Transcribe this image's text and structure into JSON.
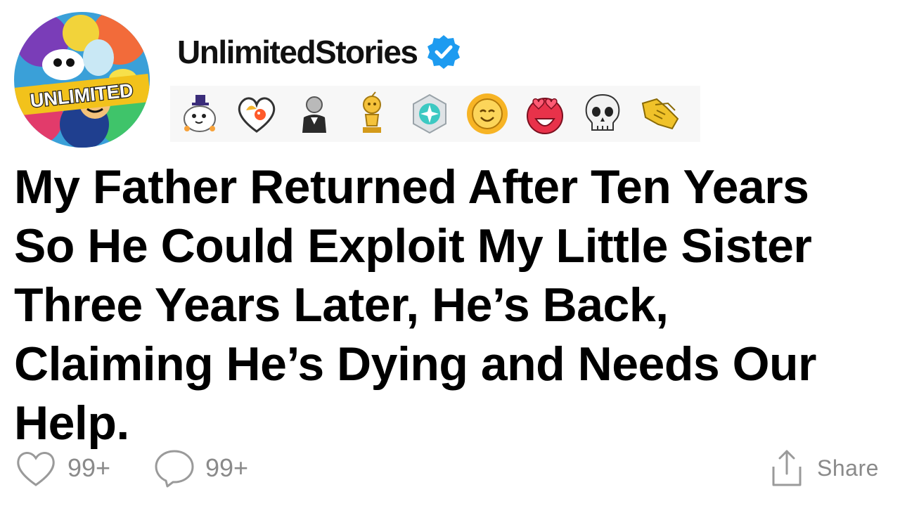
{
  "avatar": {
    "badge_text": "UNLIMITED"
  },
  "user": {
    "username": "UnlimitedStories",
    "verified": true,
    "verified_color": "#1d9bf0"
  },
  "awards": [
    {
      "name": "wholesome-seal-award-icon"
    },
    {
      "name": "heartwarming-award-icon"
    },
    {
      "name": "silver-statue-award-icon"
    },
    {
      "name": "gold-trophy-award-icon"
    },
    {
      "name": "gem-hexagon-award-icon"
    },
    {
      "name": "smiling-sun-award-icon"
    },
    {
      "name": "heart-eyes-award-icon"
    },
    {
      "name": "skull-award-icon"
    },
    {
      "name": "handshake-award-icon"
    }
  ],
  "post": {
    "title_lines": [
      "My Father Returned After Ten Years",
      "So He Could Exploit My Little Sister",
      "Three Years Later, He’s Back,",
      "Claiming He’s Dying and Needs Our",
      "Help."
    ]
  },
  "actions": {
    "likes": "99+",
    "comments": "99+",
    "share_label": "Share"
  },
  "colors": {
    "text": "#000000",
    "muted": "#8a8a8a",
    "award_bar_bg": "#f7f7f7"
  }
}
